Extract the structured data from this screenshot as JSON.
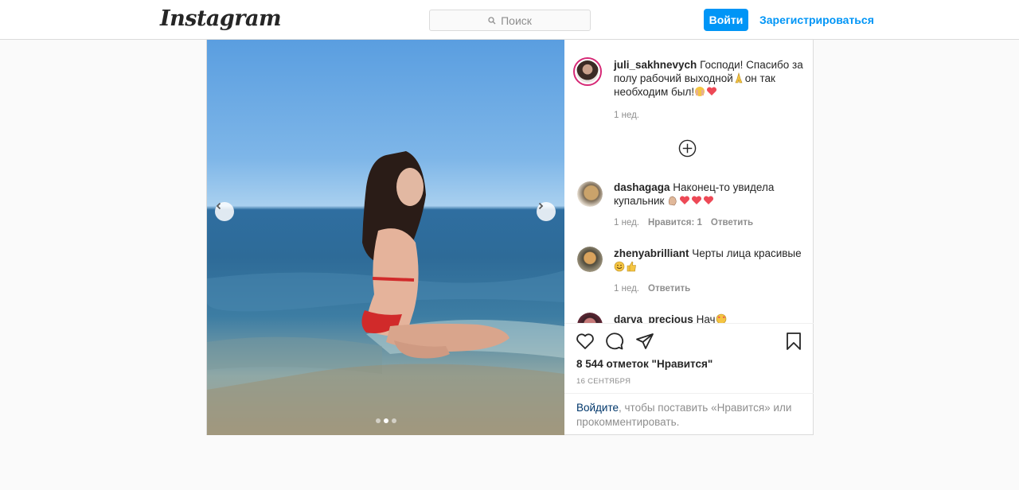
{
  "header": {
    "logo_text": "Instagram",
    "search_placeholder": "Поиск",
    "login_label": "Войти",
    "signup_label": "Зарегистрироваться"
  },
  "post": {
    "carousel": {
      "slide_count": 3,
      "active_slide": 2
    },
    "caption": {
      "username": "juli_sakhnevych",
      "text_part1": " Господи! Спасибо за полу рабочий выходной",
      "text_part2": "он так необходим был!",
      "time": "1 нед."
    },
    "comments": [
      {
        "username": "dashagaga",
        "text": " Наконец-то увидела купальник ",
        "time": "1 нед.",
        "likes": "Нравится: 1",
        "reply": "Ответить"
      },
      {
        "username": "zhenyabrilliant",
        "text": " Черты лица красивые",
        "time": "1 нед.",
        "reply": "Ответить"
      },
      {
        "username": "darya_precious",
        "text": " Нач"
      }
    ],
    "likes_count": "8 544 отметок \"Нравится\"",
    "date": "16 СЕНТЯБРЯ",
    "login_prompt": {
      "link": "Войдите",
      "text": ", чтобы поставить «Нравится» или прокомментировать."
    }
  },
  "colors": {
    "accent": "#0095f6",
    "heart_red": "#ed4956",
    "muted": "#8e8e8e"
  }
}
